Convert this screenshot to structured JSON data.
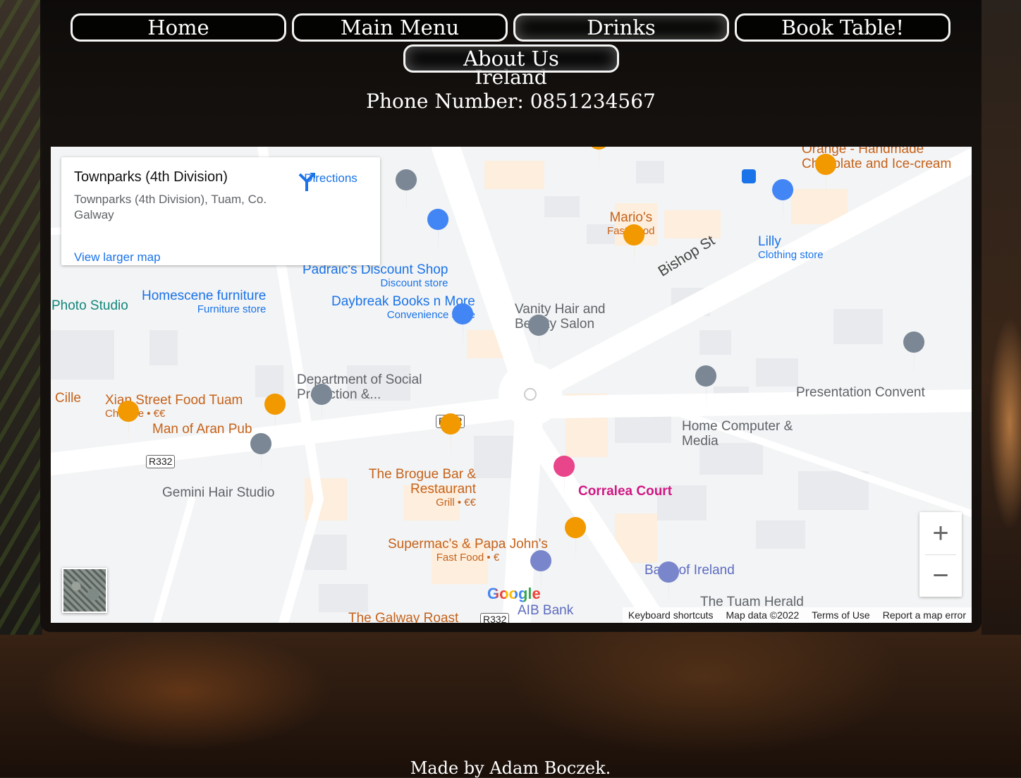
{
  "nav": {
    "home": "Home",
    "main_menu": "Main Menu",
    "drinks": "Drinks",
    "book_table": "Book Table!",
    "about_us": "About Us"
  },
  "contact": {
    "country": "Ireland",
    "phone": "Phone Number: 0851234567"
  },
  "map": {
    "info_card": {
      "title": "Townparks (4th Division)",
      "address": "Townparks (4th Division), Tuam, Co. Galway",
      "directions_label": "Directions",
      "larger_map_label": "View larger map"
    },
    "places": [
      {
        "name": "Orange - Handmade",
        "sub": "Chocolate and Ice-cream"
      },
      {
        "name": "Mario's",
        "sub": "Fast Food"
      },
      {
        "name": "Lilly",
        "sub": "Clothing store"
      },
      {
        "name": "Padraic's Discount Shop",
        "sub": "Discount store"
      },
      {
        "name": "Daybreak Books n More",
        "sub": "Convenience store"
      },
      {
        "name": "Homescene furniture",
        "sub": "Furniture store"
      },
      {
        "name": "Photo Studio",
        "sub": ""
      },
      {
        "name": "Vanity Hair and Beauty Salon",
        "sub": ""
      },
      {
        "name": "Department of Social Protection &...",
        "sub": ""
      },
      {
        "name": "Xian Street Food Tuam",
        "sub": "Chinese • €€"
      },
      {
        "name": "Man of Aran Pub",
        "sub": ""
      },
      {
        "name": "Cille",
        "sub": ""
      },
      {
        "name": "Gemini Hair Studio",
        "sub": ""
      },
      {
        "name": "The Brogue Bar & Restaurant",
        "sub": "Grill • €€"
      },
      {
        "name": "Corralea Court",
        "sub": ""
      },
      {
        "name": "Home Computer & Media",
        "sub": ""
      },
      {
        "name": "Presentation Convent",
        "sub": ""
      },
      {
        "name": "Supermac's & Papa John's",
        "sub": "Fast Food • €"
      },
      {
        "name": "Bank of Ireland",
        "sub": ""
      },
      {
        "name": "AIB Bank",
        "sub": ""
      },
      {
        "name": "The Tuam Herald",
        "sub": ""
      },
      {
        "name": "The Galway Roast",
        "sub": ""
      }
    ],
    "street": "Bishop St",
    "road_shield": "R332",
    "google": "Google",
    "footer": {
      "shortcuts": "Keyboard shortcuts",
      "map_data": "Map data ©2022",
      "terms": "Terms of Use",
      "report": "Report a map error"
    }
  },
  "footer": {
    "credit": "Made by Adam Boczek."
  }
}
